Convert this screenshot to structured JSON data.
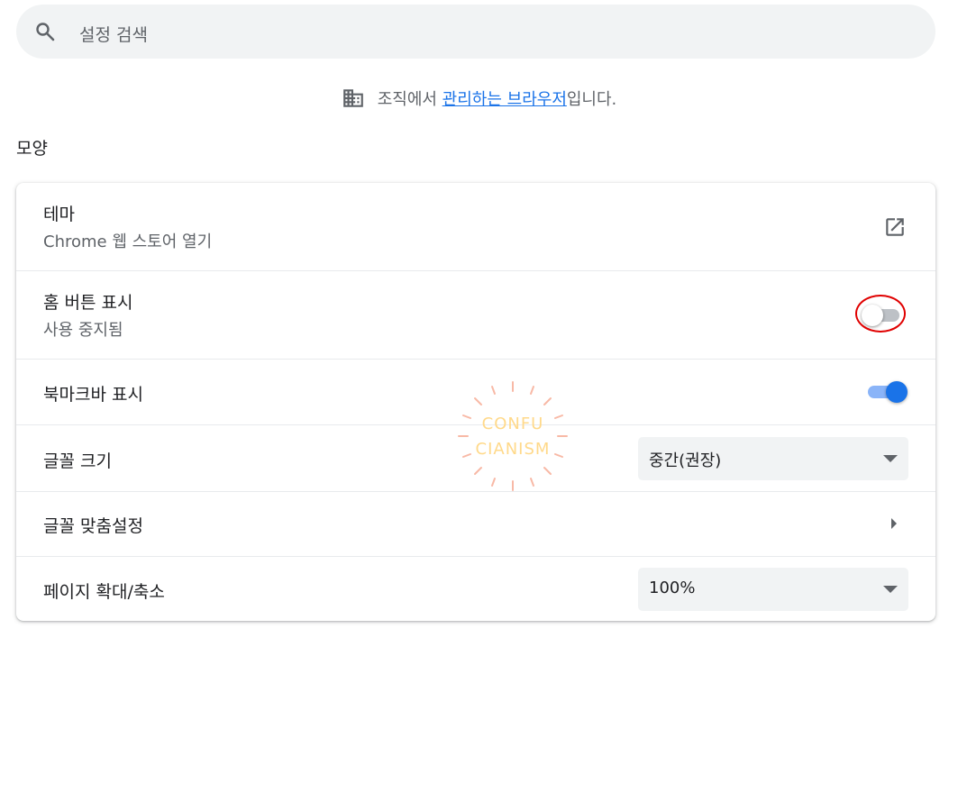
{
  "search": {
    "placeholder": "설정 검색",
    "icon": "search-icon"
  },
  "managed_notice": {
    "prefix": "조직에서 ",
    "link": "관리하는 브라우저",
    "suffix": "입니다.",
    "icon": "building-icon"
  },
  "section": {
    "title": "모양"
  },
  "rows": {
    "theme": {
      "label": "테마",
      "sub": "Chrome 웹 스토어 열기",
      "icon": "open-in-new-icon"
    },
    "home_button": {
      "label": "홈 버튼 표시",
      "sub": "사용 중지됨",
      "toggle_on": false
    },
    "bookmarks_bar": {
      "label": "북마크바 표시",
      "toggle_on": true
    },
    "font_size": {
      "label": "글꼴 크기",
      "value": "중간(권장)"
    },
    "customize_fonts": {
      "label": "글꼴 맞춤설정"
    },
    "page_zoom": {
      "label": "페이지 확대/축소",
      "value": "100%"
    }
  },
  "watermark": {
    "line1": "CONFU",
    "line2": "CIANISM"
  },
  "colors": {
    "accent": "#1a73e8",
    "link": "#1a73e8",
    "highlight": "#e00000",
    "search_bg": "#f1f3f4"
  }
}
